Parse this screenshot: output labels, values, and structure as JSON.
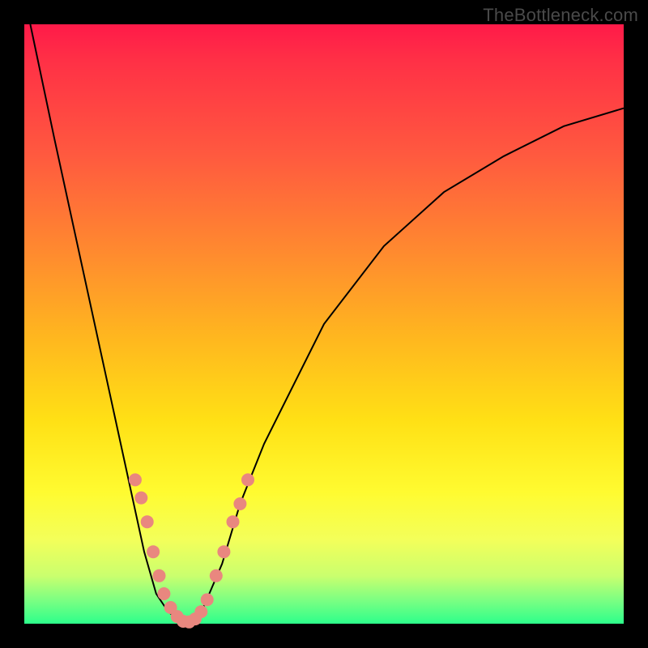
{
  "watermark": "TheBottleneck.com",
  "colors": {
    "frame": "#000000",
    "curve": "#000000",
    "marker": "#e9877f"
  },
  "chart_data": {
    "type": "line",
    "title": "",
    "xlabel": "",
    "ylabel": "",
    "xlim": [
      0,
      100
    ],
    "ylim": [
      0,
      100
    ],
    "series": [
      {
        "name": "curve-left",
        "x": [
          1,
          5,
          10,
          15,
          20,
          22,
          24,
          26,
          27
        ],
        "y": [
          100,
          81,
          58,
          35,
          12,
          5,
          2,
          0.5,
          0
        ]
      },
      {
        "name": "curve-right",
        "x": [
          27,
          28,
          30,
          33,
          36,
          40,
          50,
          60,
          70,
          80,
          90,
          100
        ],
        "y": [
          0,
          0.5,
          3,
          10,
          20,
          30,
          50,
          63,
          72,
          78,
          83,
          86
        ]
      }
    ],
    "markers": {
      "name": "highlighted-points",
      "points": [
        {
          "x": 18.5,
          "y": 24
        },
        {
          "x": 19.5,
          "y": 21
        },
        {
          "x": 20.5,
          "y": 17
        },
        {
          "x": 21.5,
          "y": 12
        },
        {
          "x": 22.5,
          "y": 8
        },
        {
          "x": 23.3,
          "y": 5
        },
        {
          "x": 24.4,
          "y": 2.7
        },
        {
          "x": 25.5,
          "y": 1.2
        },
        {
          "x": 26.5,
          "y": 0.4
        },
        {
          "x": 27.5,
          "y": 0.3
        },
        {
          "x": 28.5,
          "y": 0.8
        },
        {
          "x": 29.5,
          "y": 2
        },
        {
          "x": 30.5,
          "y": 4
        },
        {
          "x": 32.0,
          "y": 8
        },
        {
          "x": 33.3,
          "y": 12
        },
        {
          "x": 34.8,
          "y": 17
        },
        {
          "x": 36.0,
          "y": 20
        },
        {
          "x": 37.3,
          "y": 24
        }
      ]
    }
  }
}
